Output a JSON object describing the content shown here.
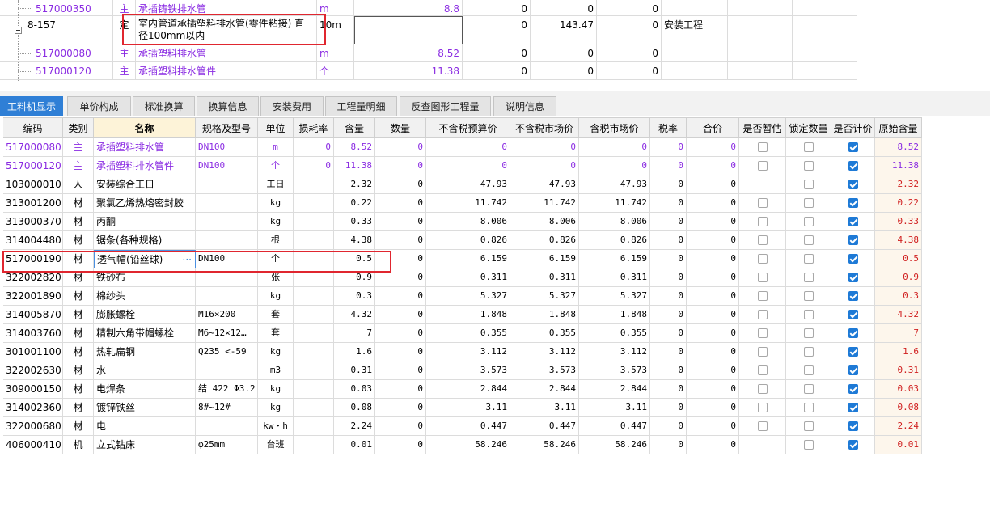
{
  "top_rows": [
    {
      "code": "517000350",
      "type": "主",
      "name": "承插铸铁排水管",
      "unit": "m",
      "qty": "8.8",
      "v1": "0",
      "v2": "0",
      "v3": "0",
      "cat": ""
    },
    {
      "code": "8-157",
      "type": "定",
      "name": "室内管道承插塑料排水管(零件粘接) 直径100mm以内",
      "unit": "10m",
      "qty": "",
      "v1": "0",
      "v2": "143.47",
      "v3": "0",
      "cat": "安装工程"
    },
    {
      "code": "517000080",
      "type": "主",
      "name": "承插塑料排水管",
      "unit": "m",
      "qty": "8.52",
      "v1": "0",
      "v2": "0",
      "v3": "0",
      "cat": ""
    },
    {
      "code": "517000120",
      "type": "主",
      "name": "承插塑料排水管件",
      "unit": "个",
      "qty": "11.38",
      "v1": "0",
      "v2": "0",
      "v3": "0",
      "cat": ""
    }
  ],
  "tabs": [
    "工料机显示",
    "单价构成",
    "标准换算",
    "换算信息",
    "安装费用",
    "工程量明细",
    "反查图形工程量",
    "说明信息"
  ],
  "headers": [
    "编码",
    "类别",
    "名称",
    "规格及型号",
    "单位",
    "损耗率",
    "含量",
    "数量",
    "不含税预算价",
    "不含税市场价",
    "含税市场价",
    "税率",
    "合价",
    "是否暂估",
    "锁定数量",
    "是否计价",
    "原始含量"
  ],
  "rows": [
    {
      "code": "517000080",
      "type": "主",
      "name": "承插塑料排水管",
      "spec": "DN100",
      "unit": "m",
      "loss": "0",
      "content": "8.52",
      "qty": "0",
      "p1": "0",
      "p2": "0",
      "p3": "0",
      "tax": "0",
      "total": "0",
      "est": false,
      "lock": false,
      "price": true,
      "orig": "8.52",
      "purple": true
    },
    {
      "code": "517000120",
      "type": "主",
      "name": "承插塑料排水管件",
      "spec": "DN100",
      "unit": "个",
      "loss": "0",
      "content": "11.38",
      "qty": "0",
      "p1": "0",
      "p2": "0",
      "p3": "0",
      "tax": "0",
      "total": "0",
      "est": false,
      "lock": false,
      "price": true,
      "orig": "11.38",
      "purple": true
    },
    {
      "code": "103000010",
      "type": "人",
      "name": "安装综合工日",
      "spec": "",
      "unit": "工日",
      "loss": "",
      "content": "2.32",
      "qty": "0",
      "p1": "47.93",
      "p2": "47.93",
      "p3": "47.93",
      "tax": "0",
      "total": "0",
      "est": null,
      "lock": false,
      "price": true,
      "orig": "2.32",
      "purple": false
    },
    {
      "code": "313001200",
      "type": "材",
      "name": "聚氯乙烯热熔密封胶",
      "spec": "",
      "unit": "kg",
      "loss": "",
      "content": "0.22",
      "qty": "0",
      "p1": "11.742",
      "p2": "11.742",
      "p3": "11.742",
      "tax": "0",
      "total": "0",
      "est": false,
      "lock": false,
      "price": true,
      "orig": "0.22",
      "purple": false
    },
    {
      "code": "313000370",
      "type": "材",
      "name": "丙酮",
      "spec": "",
      "unit": "kg",
      "loss": "",
      "content": "0.33",
      "qty": "0",
      "p1": "8.006",
      "p2": "8.006",
      "p3": "8.006",
      "tax": "0",
      "total": "0",
      "est": false,
      "lock": false,
      "price": true,
      "orig": "0.33",
      "purple": false
    },
    {
      "code": "314004480",
      "type": "材",
      "name": "锯条(各种规格)",
      "spec": "",
      "unit": "根",
      "loss": "",
      "content": "4.38",
      "qty": "0",
      "p1": "0.826",
      "p2": "0.826",
      "p3": "0.826",
      "tax": "0",
      "total": "0",
      "est": false,
      "lock": false,
      "price": true,
      "orig": "4.38",
      "purple": false
    },
    {
      "code": "517000190",
      "type": "材",
      "name": "透气帽(铅丝球)",
      "spec": "DN100",
      "unit": "个",
      "loss": "",
      "content": "0.5",
      "qty": "0",
      "p1": "6.159",
      "p2": "6.159",
      "p3": "6.159",
      "tax": "0",
      "total": "0",
      "est": false,
      "lock": false,
      "price": true,
      "orig": "0.5",
      "purple": false
    },
    {
      "code": "322002820",
      "type": "材",
      "name": "铁砂布",
      "spec": "",
      "unit": "张",
      "loss": "",
      "content": "0.9",
      "qty": "0",
      "p1": "0.311",
      "p2": "0.311",
      "p3": "0.311",
      "tax": "0",
      "total": "0",
      "est": false,
      "lock": false,
      "price": true,
      "orig": "0.9",
      "purple": false
    },
    {
      "code": "322001890",
      "type": "材",
      "name": "棉纱头",
      "spec": "",
      "unit": "kg",
      "loss": "",
      "content": "0.3",
      "qty": "0",
      "p1": "5.327",
      "p2": "5.327",
      "p3": "5.327",
      "tax": "0",
      "total": "0",
      "est": false,
      "lock": false,
      "price": true,
      "orig": "0.3",
      "purple": false
    },
    {
      "code": "314005870",
      "type": "材",
      "name": "膨胀螺栓",
      "spec": "M16×200",
      "unit": "套",
      "loss": "",
      "content": "4.32",
      "qty": "0",
      "p1": "1.848",
      "p2": "1.848",
      "p3": "1.848",
      "tax": "0",
      "total": "0",
      "est": false,
      "lock": false,
      "price": true,
      "orig": "4.32",
      "purple": false
    },
    {
      "code": "314003760",
      "type": "材",
      "name": "精制六角带帽螺栓",
      "spec": "M6~12×12…",
      "unit": "套",
      "loss": "",
      "content": "7",
      "qty": "0",
      "p1": "0.355",
      "p2": "0.355",
      "p3": "0.355",
      "tax": "0",
      "total": "0",
      "est": false,
      "lock": false,
      "price": true,
      "orig": "7",
      "purple": false
    },
    {
      "code": "301001100",
      "type": "材",
      "name": "热轧扁钢",
      "spec": "Q235 <-59",
      "unit": "kg",
      "loss": "",
      "content": "1.6",
      "qty": "0",
      "p1": "3.112",
      "p2": "3.112",
      "p3": "3.112",
      "tax": "0",
      "total": "0",
      "est": false,
      "lock": false,
      "price": true,
      "orig": "1.6",
      "purple": false
    },
    {
      "code": "322002630",
      "type": "材",
      "name": "水",
      "spec": "",
      "unit": "m3",
      "loss": "",
      "content": "0.31",
      "qty": "0",
      "p1": "3.573",
      "p2": "3.573",
      "p3": "3.573",
      "tax": "0",
      "total": "0",
      "est": false,
      "lock": false,
      "price": true,
      "orig": "0.31",
      "purple": false
    },
    {
      "code": "309000150",
      "type": "材",
      "name": "电焊条",
      "spec": "结 422 Φ3.2",
      "unit": "kg",
      "loss": "",
      "content": "0.03",
      "qty": "0",
      "p1": "2.844",
      "p2": "2.844",
      "p3": "2.844",
      "tax": "0",
      "total": "0",
      "est": false,
      "lock": false,
      "price": true,
      "orig": "0.03",
      "purple": false
    },
    {
      "code": "314002360",
      "type": "材",
      "name": "镀锌铁丝",
      "spec": "8#~12#",
      "unit": "kg",
      "loss": "",
      "content": "0.08",
      "qty": "0",
      "p1": "3.11",
      "p2": "3.11",
      "p3": "3.11",
      "tax": "0",
      "total": "0",
      "est": false,
      "lock": false,
      "price": true,
      "orig": "0.08",
      "purple": false
    },
    {
      "code": "322000680",
      "type": "材",
      "name": "电",
      "spec": "",
      "unit": "kw・h",
      "loss": "",
      "content": "2.24",
      "qty": "0",
      "p1": "0.447",
      "p2": "0.447",
      "p3": "0.447",
      "tax": "0",
      "total": "0",
      "est": false,
      "lock": false,
      "price": true,
      "orig": "2.24",
      "purple": false
    },
    {
      "code": "406000410",
      "type": "机",
      "name": "立式钻床",
      "spec": "φ25mm",
      "unit": "台班",
      "loss": "",
      "content": "0.01",
      "qty": "0",
      "p1": "58.246",
      "p2": "58.246",
      "p3": "58.246",
      "tax": "0",
      "total": "0",
      "est": null,
      "lock": false,
      "price": true,
      "orig": "0.01",
      "purple": false
    }
  ],
  "edit_more": "···",
  "tree_minus_icon": "minus-icon"
}
